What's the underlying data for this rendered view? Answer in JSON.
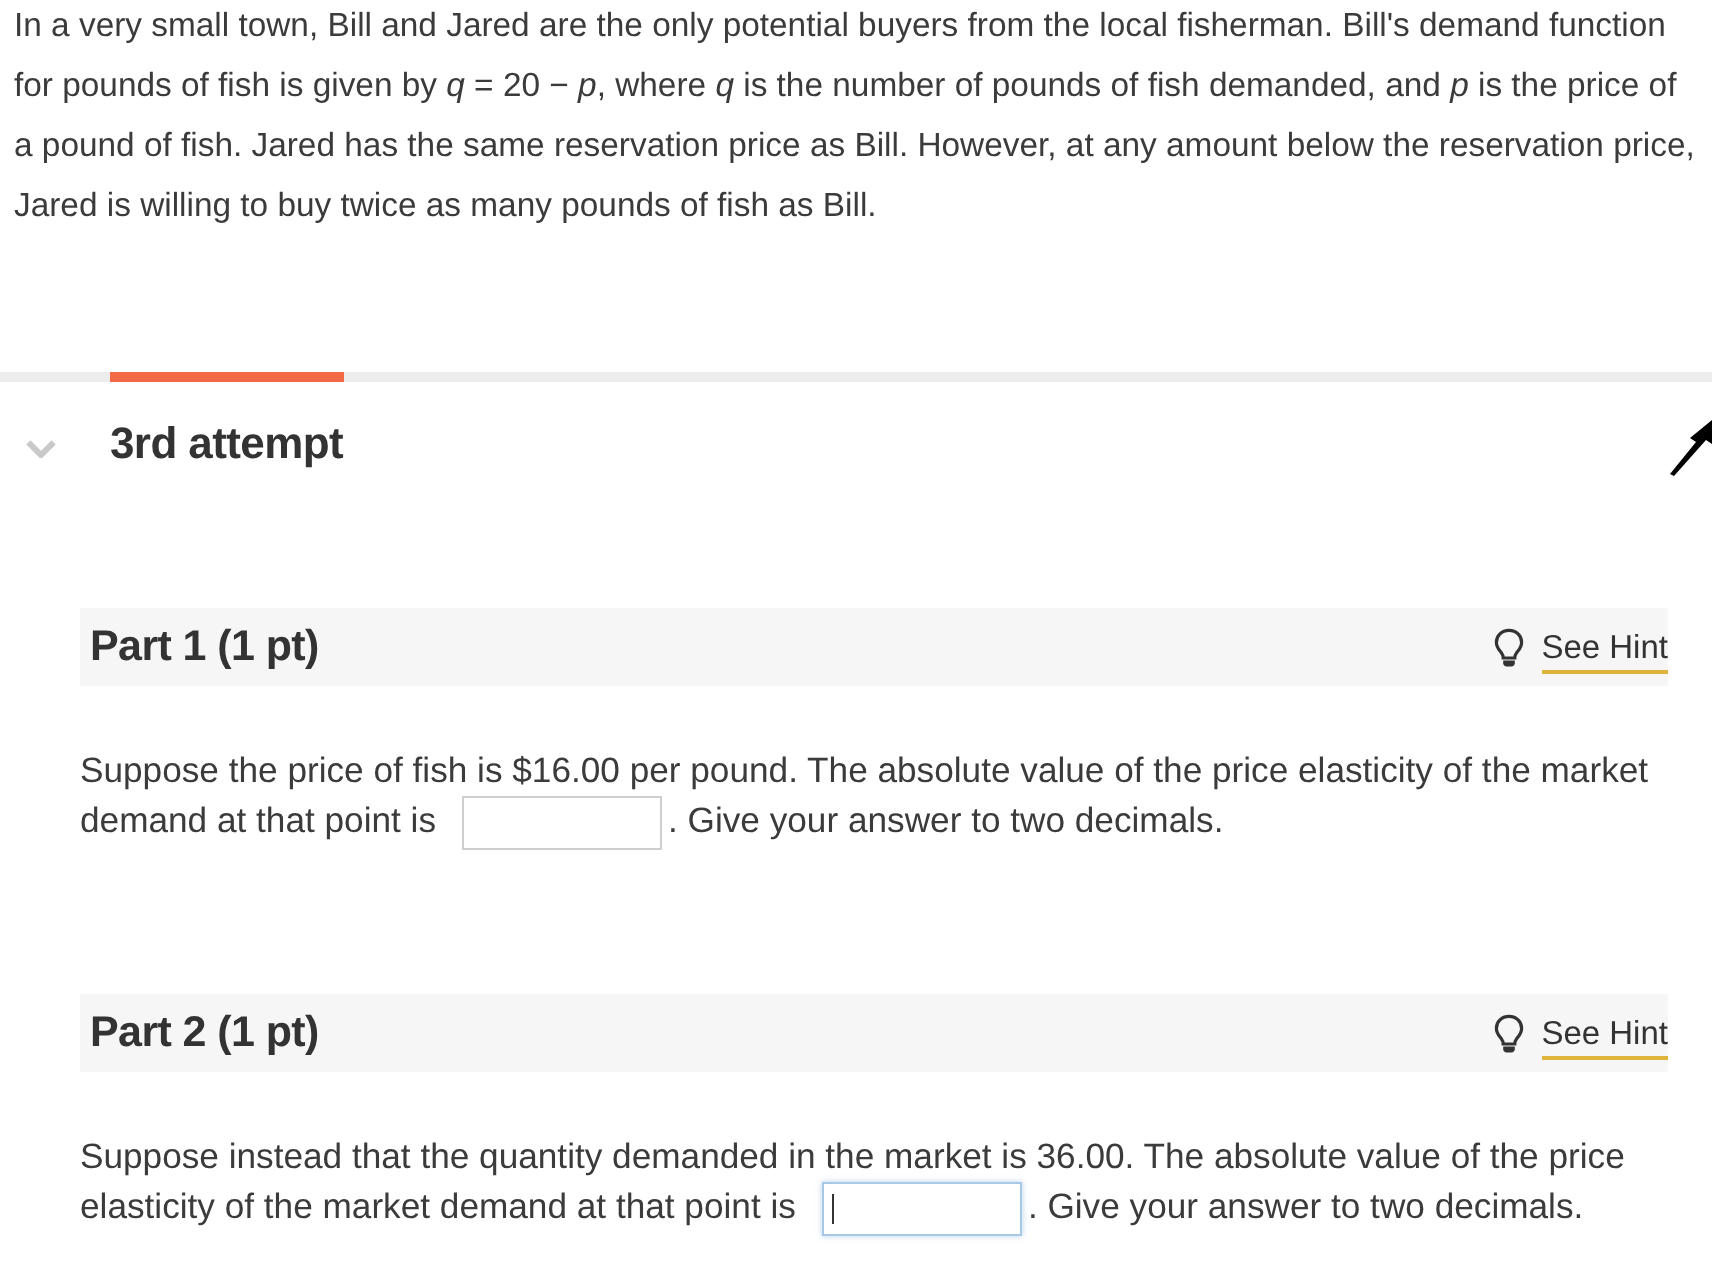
{
  "problem": {
    "text": "In a very small town, Bill and Jared are the only potential buyers from the local fisherman. Bill's demand function for pounds of fish is given by *q* = 20 − *p*, where *q* is the number of pounds of fish demanded, and *p* is the price of a pound of fish. Jared has the same reservation price as Bill. However, at any amount below the reservation price, Jared is willing to buy twice as many pounds of fish as Bill."
  },
  "attempt": {
    "title": "3rd attempt",
    "selected": true,
    "expanded": true
  },
  "parts": [
    {
      "title": "Part 1 (1 pt)",
      "hint": "See Hint",
      "prompt": "Suppose the price of fish is $16.00 per pound. The absolute value of the price elasticity of the market demand at that point is",
      "answer": {
        "focused": false
      },
      "after": ". Give your answer to two decimals."
    },
    {
      "title": "Part 2 (1 pt)",
      "hint": "See Hint",
      "prompt": "Suppose instead that the quantity demanded in the market is 36.00. The absolute value of the price elasticity of the market demand at that point is",
      "answer": {
        "focused": true
      },
      "after": ". Give your answer to two decimals."
    }
  ]
}
